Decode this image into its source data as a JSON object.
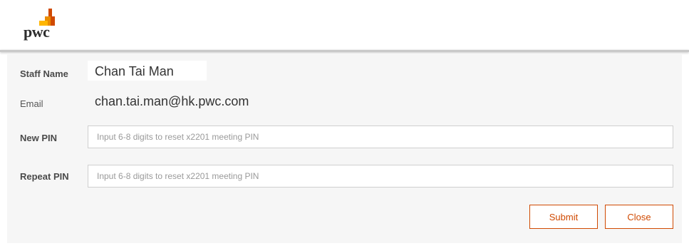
{
  "header": {
    "logo_text": "pwc"
  },
  "form": {
    "staff_name": {
      "label": "Staff Name",
      "value": "Chan Tai Man"
    },
    "email": {
      "label": "Email",
      "value": "chan.tai.man@hk.pwc.com"
    },
    "new_pin": {
      "label": "New PIN",
      "placeholder": "Input 6-8 digits to reset x2201 meeting PIN",
      "value": ""
    },
    "repeat_pin": {
      "label": "Repeat PIN",
      "placeholder": "Input 6-8 digits to reset x2201 meeting PIN",
      "value": ""
    }
  },
  "actions": {
    "submit_label": "Submit",
    "close_label": "Close"
  },
  "colors": {
    "accent": "#d04a02",
    "logo_orange": "#eb8c00",
    "logo_red": "#d04a02",
    "logo_yellow": "#ffb600"
  }
}
